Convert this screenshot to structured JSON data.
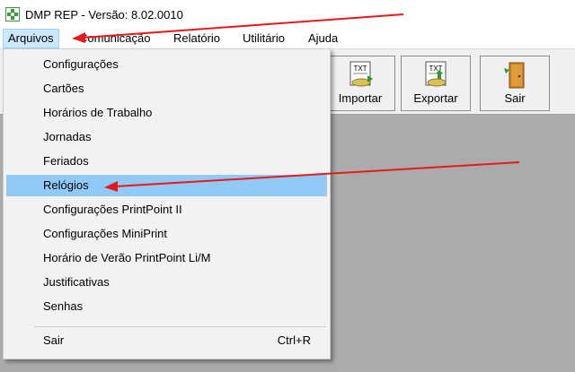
{
  "window": {
    "title": "DMP REP - Versão: 8.02.0010",
    "icon": "app-logo-icon"
  },
  "menubar": {
    "items": [
      {
        "label": "Arquivos",
        "active": true
      },
      {
        "label": "Comunicação",
        "active": false
      },
      {
        "label": "Relatório",
        "active": false
      },
      {
        "label": "Utilitário",
        "active": false
      },
      {
        "label": "Ajuda",
        "active": false
      }
    ]
  },
  "toolbar": {
    "buttons": [
      {
        "label": "Importar",
        "icon": "txt-import-icon"
      },
      {
        "label": "Exportar",
        "icon": "txt-export-icon"
      },
      {
        "label": "Sair",
        "icon": "exit-door-icon"
      }
    ]
  },
  "dropdown": {
    "items": [
      {
        "label": "Configurações"
      },
      {
        "label": "Cartões"
      },
      {
        "label": "Horários de Trabalho"
      },
      {
        "label": "Jornadas"
      },
      {
        "label": "Feriados"
      },
      {
        "label": "Relógios",
        "highlighted": true
      },
      {
        "label": "Configurações PrintPoint II"
      },
      {
        "label": "Configurações MiniPrint"
      },
      {
        "label": "Horário de Verão PrintPoint Li/M"
      },
      {
        "label": "Justificativas"
      },
      {
        "label": "Senhas"
      },
      {
        "label": "Sair",
        "shortcut": "Ctrl+R"
      }
    ]
  },
  "colors": {
    "highlight": "#91c9f7",
    "menu_active": "#cce8ff",
    "workspace": "#ababab",
    "annotation_arrow": "#e31b1b"
  }
}
